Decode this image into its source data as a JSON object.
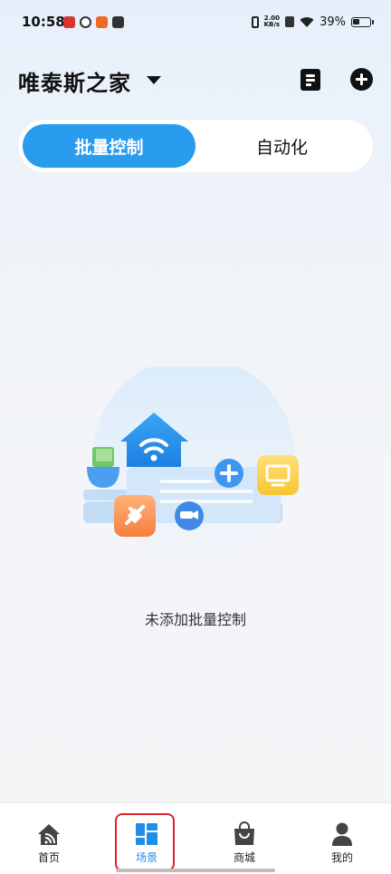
{
  "status_bar": {
    "time": "10:58",
    "net_speed_value": "2.00",
    "net_speed_unit": "KB/s",
    "battery_percent": "39%"
  },
  "header": {
    "home_name": "唯泰斯之家"
  },
  "tabs": [
    {
      "label": "批量控制",
      "active": true
    },
    {
      "label": "自动化",
      "active": false
    }
  ],
  "empty_state": {
    "message": "未添加批量控制"
  },
  "bottom_nav": [
    {
      "label": "首页",
      "icon": "home-icon",
      "active": false
    },
    {
      "label": "场景",
      "icon": "scene-grid-icon",
      "active": true
    },
    {
      "label": "商城",
      "icon": "shopping-bag-icon",
      "active": false
    },
    {
      "label": "我的",
      "icon": "person-icon",
      "active": false
    }
  ],
  "colors": {
    "accent": "#2a9cee",
    "active_nav": "#1f8ee8",
    "highlight": "#e0202a"
  }
}
